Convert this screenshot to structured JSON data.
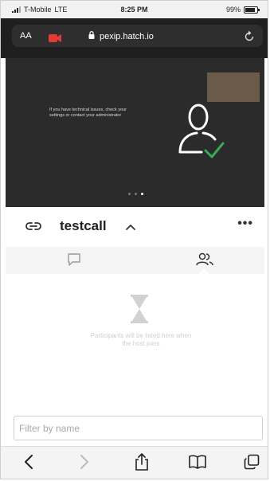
{
  "status_bar": {
    "carrier": "T-Mobile",
    "network": "LTE",
    "time": "8:25 PM",
    "battery": "99%"
  },
  "browser": {
    "text_size_label": "AA",
    "host": "pexip.hatch.io"
  },
  "video": {
    "message": "If you have technical issues, check your settings or contact your administrator",
    "carousel_active": 2,
    "carousel_count": 3
  },
  "call": {
    "name": "testcall",
    "more_label": "•••"
  },
  "participants": {
    "empty_message": "Participants will be listed here when the host joins"
  },
  "filter": {
    "placeholder": "Filter by name",
    "value": ""
  },
  "icons": {
    "status": [
      "signal-icon",
      "battery-icon"
    ],
    "urlbar": [
      "camera-icon",
      "lock-icon",
      "reload-icon"
    ],
    "video": [
      "user-check-icon"
    ],
    "call": [
      "link-icon",
      "chevron-up-icon",
      "more-icon"
    ],
    "tabs": [
      "chat-icon",
      "people-icon"
    ],
    "empty": [
      "hourglass-icon"
    ],
    "toolbar": [
      "back-icon",
      "forward-icon",
      "share-icon",
      "bookmarks-icon",
      "tabs-icon"
    ]
  },
  "colors": {
    "accent_check": "#3aaa5a",
    "camera_red": "#e53935",
    "video_bg": "#2b2b2b"
  }
}
